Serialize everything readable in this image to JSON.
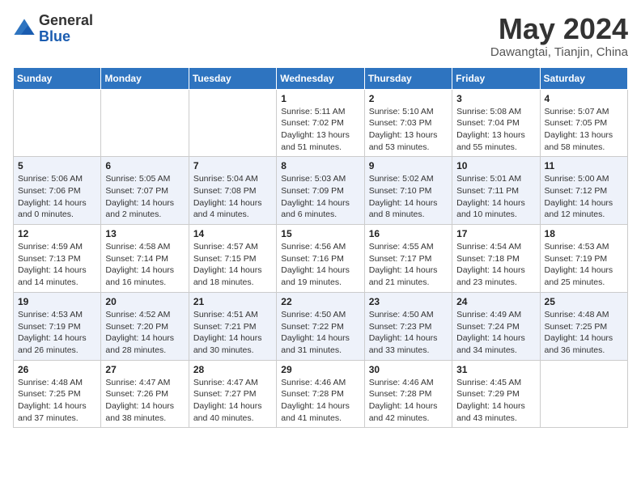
{
  "header": {
    "logo_general": "General",
    "logo_blue": "Blue",
    "month_title": "May 2024",
    "location": "Dawangtai, Tianjin, China"
  },
  "weekdays": [
    "Sunday",
    "Monday",
    "Tuesday",
    "Wednesday",
    "Thursday",
    "Friday",
    "Saturday"
  ],
  "weeks": [
    [
      {
        "day": "",
        "info": ""
      },
      {
        "day": "",
        "info": ""
      },
      {
        "day": "",
        "info": ""
      },
      {
        "day": "1",
        "info": "Sunrise: 5:11 AM\nSunset: 7:02 PM\nDaylight: 13 hours\nand 51 minutes."
      },
      {
        "day": "2",
        "info": "Sunrise: 5:10 AM\nSunset: 7:03 PM\nDaylight: 13 hours\nand 53 minutes."
      },
      {
        "day": "3",
        "info": "Sunrise: 5:08 AM\nSunset: 7:04 PM\nDaylight: 13 hours\nand 55 minutes."
      },
      {
        "day": "4",
        "info": "Sunrise: 5:07 AM\nSunset: 7:05 PM\nDaylight: 13 hours\nand 58 minutes."
      }
    ],
    [
      {
        "day": "5",
        "info": "Sunrise: 5:06 AM\nSunset: 7:06 PM\nDaylight: 14 hours\nand 0 minutes."
      },
      {
        "day": "6",
        "info": "Sunrise: 5:05 AM\nSunset: 7:07 PM\nDaylight: 14 hours\nand 2 minutes."
      },
      {
        "day": "7",
        "info": "Sunrise: 5:04 AM\nSunset: 7:08 PM\nDaylight: 14 hours\nand 4 minutes."
      },
      {
        "day": "8",
        "info": "Sunrise: 5:03 AM\nSunset: 7:09 PM\nDaylight: 14 hours\nand 6 minutes."
      },
      {
        "day": "9",
        "info": "Sunrise: 5:02 AM\nSunset: 7:10 PM\nDaylight: 14 hours\nand 8 minutes."
      },
      {
        "day": "10",
        "info": "Sunrise: 5:01 AM\nSunset: 7:11 PM\nDaylight: 14 hours\nand 10 minutes."
      },
      {
        "day": "11",
        "info": "Sunrise: 5:00 AM\nSunset: 7:12 PM\nDaylight: 14 hours\nand 12 minutes."
      }
    ],
    [
      {
        "day": "12",
        "info": "Sunrise: 4:59 AM\nSunset: 7:13 PM\nDaylight: 14 hours\nand 14 minutes."
      },
      {
        "day": "13",
        "info": "Sunrise: 4:58 AM\nSunset: 7:14 PM\nDaylight: 14 hours\nand 16 minutes."
      },
      {
        "day": "14",
        "info": "Sunrise: 4:57 AM\nSunset: 7:15 PM\nDaylight: 14 hours\nand 18 minutes."
      },
      {
        "day": "15",
        "info": "Sunrise: 4:56 AM\nSunset: 7:16 PM\nDaylight: 14 hours\nand 19 minutes."
      },
      {
        "day": "16",
        "info": "Sunrise: 4:55 AM\nSunset: 7:17 PM\nDaylight: 14 hours\nand 21 minutes."
      },
      {
        "day": "17",
        "info": "Sunrise: 4:54 AM\nSunset: 7:18 PM\nDaylight: 14 hours\nand 23 minutes."
      },
      {
        "day": "18",
        "info": "Sunrise: 4:53 AM\nSunset: 7:19 PM\nDaylight: 14 hours\nand 25 minutes."
      }
    ],
    [
      {
        "day": "19",
        "info": "Sunrise: 4:53 AM\nSunset: 7:19 PM\nDaylight: 14 hours\nand 26 minutes."
      },
      {
        "day": "20",
        "info": "Sunrise: 4:52 AM\nSunset: 7:20 PM\nDaylight: 14 hours\nand 28 minutes."
      },
      {
        "day": "21",
        "info": "Sunrise: 4:51 AM\nSunset: 7:21 PM\nDaylight: 14 hours\nand 30 minutes."
      },
      {
        "day": "22",
        "info": "Sunrise: 4:50 AM\nSunset: 7:22 PM\nDaylight: 14 hours\nand 31 minutes."
      },
      {
        "day": "23",
        "info": "Sunrise: 4:50 AM\nSunset: 7:23 PM\nDaylight: 14 hours\nand 33 minutes."
      },
      {
        "day": "24",
        "info": "Sunrise: 4:49 AM\nSunset: 7:24 PM\nDaylight: 14 hours\nand 34 minutes."
      },
      {
        "day": "25",
        "info": "Sunrise: 4:48 AM\nSunset: 7:25 PM\nDaylight: 14 hours\nand 36 minutes."
      }
    ],
    [
      {
        "day": "26",
        "info": "Sunrise: 4:48 AM\nSunset: 7:25 PM\nDaylight: 14 hours\nand 37 minutes."
      },
      {
        "day": "27",
        "info": "Sunrise: 4:47 AM\nSunset: 7:26 PM\nDaylight: 14 hours\nand 38 minutes."
      },
      {
        "day": "28",
        "info": "Sunrise: 4:47 AM\nSunset: 7:27 PM\nDaylight: 14 hours\nand 40 minutes."
      },
      {
        "day": "29",
        "info": "Sunrise: 4:46 AM\nSunset: 7:28 PM\nDaylight: 14 hours\nand 41 minutes."
      },
      {
        "day": "30",
        "info": "Sunrise: 4:46 AM\nSunset: 7:28 PM\nDaylight: 14 hours\nand 42 minutes."
      },
      {
        "day": "31",
        "info": "Sunrise: 4:45 AM\nSunset: 7:29 PM\nDaylight: 14 hours\nand 43 minutes."
      },
      {
        "day": "",
        "info": ""
      }
    ]
  ]
}
